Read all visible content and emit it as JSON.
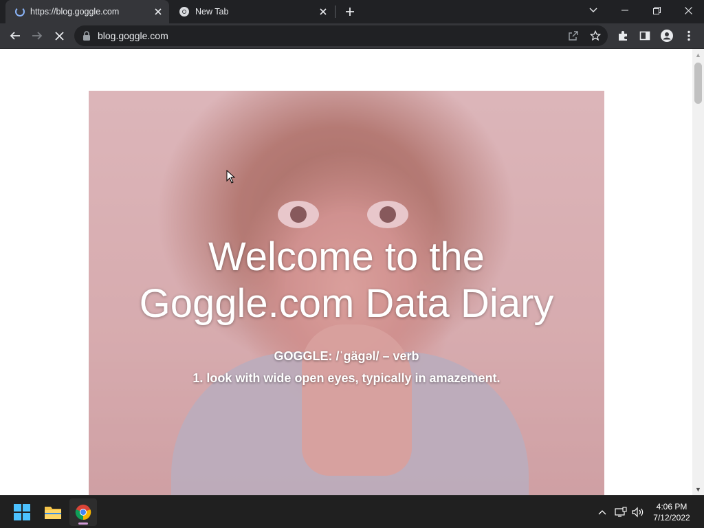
{
  "browser": {
    "tabs": [
      {
        "title": "https://blog.goggle.com",
        "loading": true,
        "active": true
      },
      {
        "title": "New Tab",
        "loading": false,
        "active": false
      }
    ],
    "address": "blog.goggle.com"
  },
  "page": {
    "hero": {
      "title_line1": "Welcome to the",
      "title_line2": "Goggle.com Data Diary",
      "definition_line1": "GOGGLE: /ˈgägəl/ – verb",
      "definition_line2": "1. look with wide open eyes, typically in amazement."
    }
  },
  "taskbar": {
    "time": "4:06 PM",
    "date": "7/12/2022"
  },
  "colors": {
    "tabstrip": "#202124",
    "toolbar": "#35363a",
    "omnibox": "#202124",
    "taskbar": "#202020",
    "chrome_indicator": "#d29cd6"
  }
}
